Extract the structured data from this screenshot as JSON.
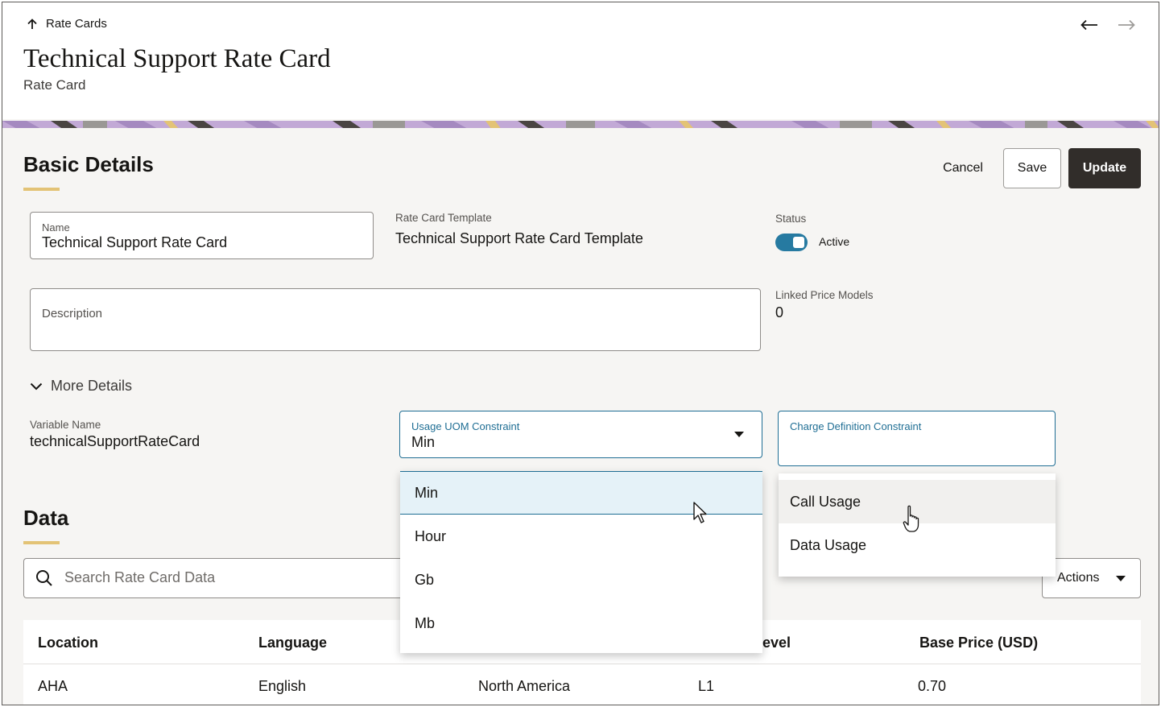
{
  "header": {
    "back_label": "Rate Cards",
    "title": "Technical Support Rate Card",
    "subtitle": "Rate Card"
  },
  "basic_details": {
    "heading": "Basic Details",
    "buttons": {
      "cancel": "Cancel",
      "save": "Save",
      "update": "Update"
    },
    "name": {
      "label": "Name",
      "value": "Technical Support Rate Card"
    },
    "template": {
      "label": "Rate Card Template",
      "value": "Technical Support Rate Card Template"
    },
    "status": {
      "label": "Status",
      "value": "Active"
    },
    "description": {
      "label": "Description",
      "value": ""
    },
    "linked_price_models": {
      "label": "Linked Price Models",
      "value": "0"
    },
    "more_details_label": "More Details",
    "variable_name": {
      "label": "Variable Name",
      "value": "technicalSupportRateCard"
    },
    "usage_uom": {
      "label": "Usage UOM Constraint",
      "value": "Min"
    },
    "charge_definition": {
      "label": "Charge Definition Constraint",
      "value": ""
    }
  },
  "uom_options": [
    "Min",
    "Hour",
    "Gb",
    "Mb"
  ],
  "charge_options": [
    "Call Usage",
    "Data Usage"
  ],
  "data_section": {
    "heading": "Data",
    "search_placeholder": "Search Rate Card Data",
    "actions_label": "Actions",
    "columns": [
      "Location",
      "Language",
      "evel",
      "Base Price (USD)"
    ],
    "rows": [
      {
        "location": "AHA",
        "language": "English",
        "region": "North America",
        "level": "L1",
        "base_price": "0.70"
      }
    ]
  },
  "colors": {
    "accent": "#e3c376",
    "focus": "#1f6e94",
    "toggle_on": "#267aa1",
    "primary_button": "#312d2a",
    "highlight": "#e5f2f8"
  }
}
